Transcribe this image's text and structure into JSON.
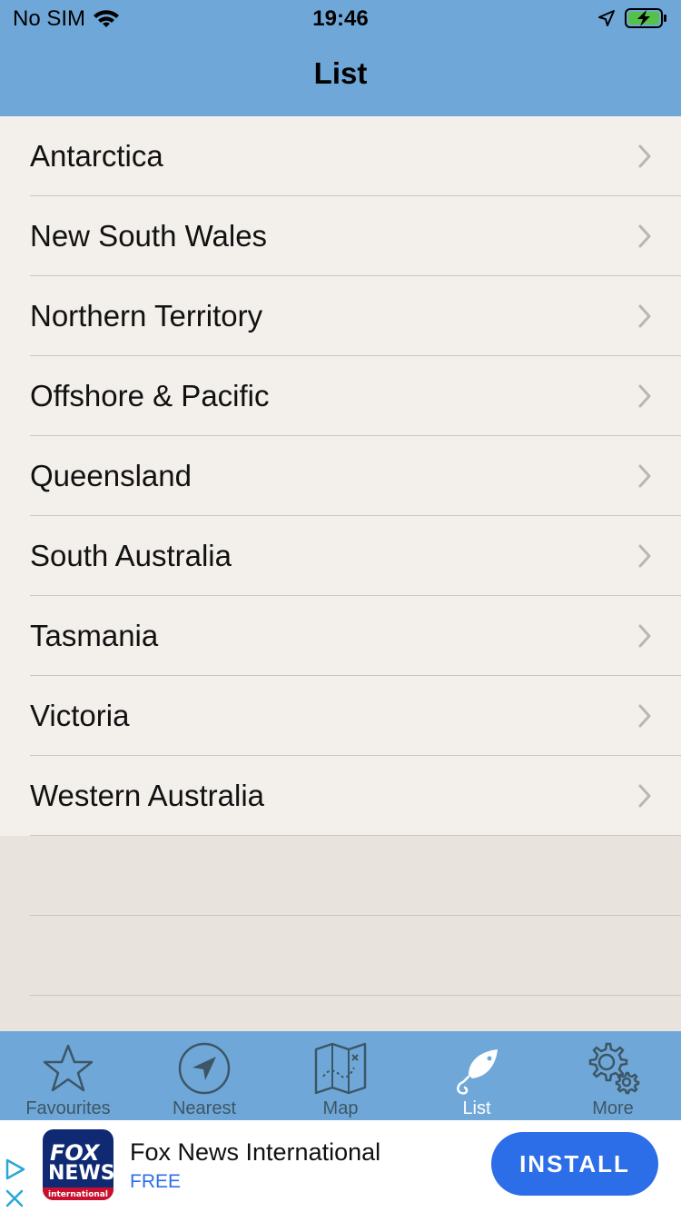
{
  "status_bar": {
    "carrier": "No SIM",
    "time": "19:46"
  },
  "nav": {
    "title": "List"
  },
  "list": {
    "items": [
      {
        "label": "Antarctica"
      },
      {
        "label": "New South Wales"
      },
      {
        "label": "Northern Territory"
      },
      {
        "label": "Offshore & Pacific"
      },
      {
        "label": "Queensland"
      },
      {
        "label": "South Australia"
      },
      {
        "label": "Tasmania"
      },
      {
        "label": "Victoria"
      },
      {
        "label": "Western Australia"
      }
    ]
  },
  "tabbar": {
    "tabs": [
      {
        "label": "Favourites",
        "icon": "star-icon"
      },
      {
        "label": "Nearest",
        "icon": "location-arrow-icon"
      },
      {
        "label": "Map",
        "icon": "map-icon"
      },
      {
        "label": "List",
        "icon": "fish-hook-icon",
        "active": true
      },
      {
        "label": "More",
        "icon": "gear-icon"
      }
    ]
  },
  "ad": {
    "app_name": "Fox News International",
    "price": "FREE",
    "install_label": "INSTALL",
    "logo_line1": "FOX",
    "logo_line2": "NEWS",
    "logo_line3": "international"
  },
  "colors": {
    "bar_blue": "#6fa8d8",
    "list_bg": "#f3f0eb",
    "install_blue": "#2c6ee8"
  }
}
